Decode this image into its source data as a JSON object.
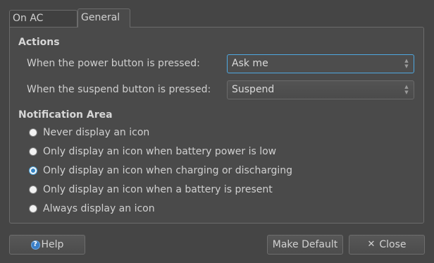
{
  "tabs": [
    {
      "label": "On AC Power",
      "active": false
    },
    {
      "label": "General",
      "active": true
    }
  ],
  "actions": {
    "title": "Actions",
    "power_button_label": "When the power button is pressed:",
    "power_button_value": "Ask me",
    "suspend_button_label": "When the suspend button is pressed:",
    "suspend_button_value": "Suspend"
  },
  "notification": {
    "title": "Notification Area",
    "options": [
      {
        "label": "Never display an icon",
        "checked": false
      },
      {
        "label": "Only display an icon when battery power is low",
        "checked": false
      },
      {
        "label": "Only display an icon when charging or discharging",
        "checked": true
      },
      {
        "label": "Only display an icon when a battery is present",
        "checked": false
      },
      {
        "label": "Always display an icon",
        "checked": false
      }
    ]
  },
  "buttons": {
    "help": "Help",
    "make_default": "Make Default",
    "close": "Close"
  },
  "icons": {
    "help": "help-icon",
    "close": "close-icon",
    "combo_arrows": "spin-arrows-icon"
  },
  "colors": {
    "background": "#454545",
    "focus_accent": "#4fa8e0",
    "radio_dot": "#3484c4"
  }
}
